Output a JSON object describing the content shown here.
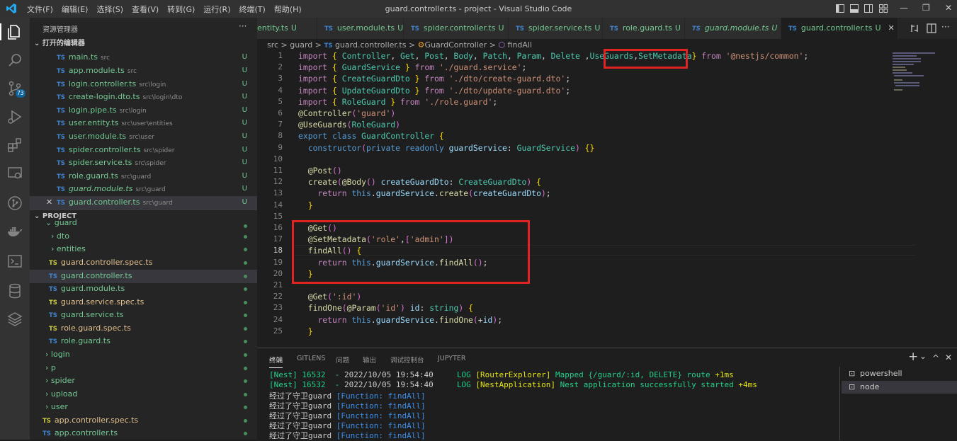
{
  "window": {
    "title": "guard.controller.ts - project - Visual Studio Code",
    "menu": [
      "文件(F)",
      "编辑(E)",
      "选择(S)",
      "查看(V)",
      "转到(G)",
      "运行(R)",
      "终端(T)",
      "帮助(H)"
    ]
  },
  "activity": {
    "scm_badge": "73"
  },
  "sidebar": {
    "title": "资源管理器",
    "more": "···",
    "open_editors_label": "打开的编辑器",
    "open_editors": [
      {
        "name": "main.ts",
        "path": "src",
        "badge": "U"
      },
      {
        "name": "app.module.ts",
        "path": "src",
        "badge": "U"
      },
      {
        "name": "login.controller.ts",
        "path": "src\\login",
        "badge": "U"
      },
      {
        "name": "create-login.dto.ts",
        "path": "src\\login\\dto",
        "badge": "U"
      },
      {
        "name": "login.pipe.ts",
        "path": "src\\login",
        "badge": "U"
      },
      {
        "name": "user.entity.ts",
        "path": "src\\user\\entities",
        "badge": "U"
      },
      {
        "name": "user.module.ts",
        "path": "src\\user",
        "badge": "U"
      },
      {
        "name": "spider.controller.ts",
        "path": "src\\spider",
        "badge": "U"
      },
      {
        "name": "spider.service.ts",
        "path": "src\\spider",
        "badge": "U"
      },
      {
        "name": "role.guard.ts",
        "path": "src\\guard",
        "badge": "U"
      },
      {
        "name": "guard.module.ts",
        "path": "src\\guard",
        "badge": "U"
      },
      {
        "name": "guard.controller.ts",
        "path": "src\\guard",
        "badge": "U"
      }
    ],
    "project_label": "PROJECT",
    "tree": [
      {
        "name": "guard",
        "chev": "⌄"
      },
      {
        "name": "dto",
        "chev": "›"
      },
      {
        "name": "entities",
        "chev": "›"
      },
      {
        "name": "guard.controller.spec.ts"
      },
      {
        "name": "guard.controller.ts"
      },
      {
        "name": "guard.module.ts"
      },
      {
        "name": "guard.service.spec.ts"
      },
      {
        "name": "guard.service.ts"
      },
      {
        "name": "role.guard.spec.ts"
      },
      {
        "name": "role.guard.ts"
      },
      {
        "name": "login",
        "chev": "›"
      },
      {
        "name": "p",
        "chev": "›"
      },
      {
        "name": "spider",
        "chev": "›"
      },
      {
        "name": "upload",
        "chev": "›"
      },
      {
        "name": "user",
        "chev": "›"
      },
      {
        "name": "app.controller.spec.ts"
      },
      {
        "name": "app.controller.ts"
      }
    ]
  },
  "tabs": [
    {
      "name": "entity.ts",
      "u": "U"
    },
    {
      "name": "user.module.ts",
      "u": "U"
    },
    {
      "name": "spider.controller.ts",
      "u": "U"
    },
    {
      "name": "spider.service.ts",
      "u": "U"
    },
    {
      "name": "role.guard.ts",
      "u": "U"
    },
    {
      "name": "guard.module.ts",
      "u": "U"
    },
    {
      "name": "guard.controller.ts",
      "u": "U"
    }
  ],
  "breadcrumb": [
    "src",
    "guard",
    "guard.controller.ts",
    "GuardController",
    "findAll"
  ],
  "editor": {
    "line_numbers": [
      "1",
      "2",
      "3",
      "4",
      "5",
      "6",
      "7",
      "8",
      "9",
      "10",
      "11",
      "12",
      "13",
      "14",
      "15",
      "16",
      "17",
      "18",
      "19",
      "20",
      "21",
      "22",
      "23",
      "24",
      "25"
    ],
    "lines": {
      "l1": "import { Controller, Get, Post, Body, Patch, Param, Delete ,UseGuards,SetMetadata} from '@nestjs/common';",
      "l2": "import { GuardService } from './guard.service';",
      "l3": "import { CreateGuardDto } from './dto/create-guard.dto';",
      "l4": "import { UpdateGuardDto } from './dto/update-guard.dto';",
      "l5": "import { RoleGuard } from './role.guard';",
      "l6": "@Controller('guard')",
      "l7": "@UseGuards(RoleGuard)",
      "l8": "export class GuardController {",
      "l9": "  constructor(private readonly guardService: GuardService) {}",
      "l11": "  @Post()",
      "l12": "  create(@Body() createGuardDto: CreateGuardDto) {",
      "l13": "    return this.guardService.create(createGuardDto);",
      "l14": "  }",
      "l16": "  @Get()",
      "l17": "  @SetMetadata('role',['admin'])",
      "l18": "  findAll() {",
      "l19": "    return this.guardService.findAll();",
      "l20": "  }",
      "l22": "  @Get(':id')",
      "l23": "  findOne(@Param('id') id: string) {",
      "l24": "    return this.guardService.findOne(+id);",
      "l25": "  }"
    }
  },
  "panel": {
    "tabs": [
      "终端",
      "GITLENS",
      "问题",
      "输出",
      "调试控制台",
      "JUPYTER"
    ],
    "terminal_lines": [
      {
        "pre": "[Nest] 16532  - ",
        "date": "2022/10/05 19:54:40",
        "log": "LOG",
        "ctx": "[RouterExplorer]",
        "msg": "Mapped {/guard/:id, DELETE} route",
        "ms": "+1ms"
      },
      {
        "pre": "[Nest] 16532  - ",
        "date": "2022/10/05 19:54:40",
        "log": "LOG",
        "ctx": "[NestApplication]",
        "msg": "Nest application successfully started",
        "ms": "+4ms"
      }
    ],
    "guard_lines": [
      "经过了守卫guard",
      "经过了守卫guard",
      "经过了守卫guard",
      "经过了守卫guard",
      "经过了守卫guard"
    ],
    "function_tag": "[Function: findAll]",
    "shells": [
      "powershell",
      "node"
    ],
    "actions": {
      "add": "+",
      "chevron": "⌄",
      "up": "^",
      "close": "✕"
    }
  }
}
